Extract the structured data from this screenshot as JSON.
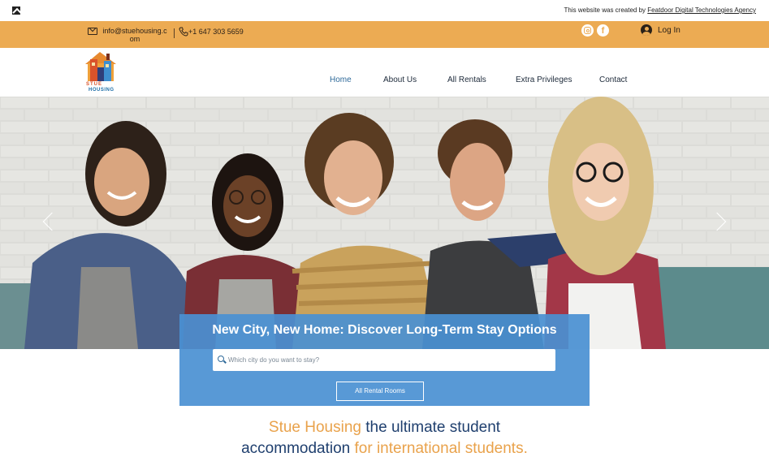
{
  "credit": {
    "text": "This website was created by",
    "link": "Featdoor Digital Technologies Agency"
  },
  "topbar": {
    "email": "info@stuehousing.com",
    "phone": "+1 647 303 5659",
    "login": "Log In"
  },
  "logo": {
    "line1": "STUE",
    "line2": "HOUSING"
  },
  "nav": {
    "items": [
      {
        "label": "Home"
      },
      {
        "label": "About Us"
      },
      {
        "label": "All Rentals"
      },
      {
        "label": "Extra Privileges"
      },
      {
        "label": "Contact"
      }
    ]
  },
  "hero": {
    "title": "New City, New Home: Discover Long-Term Stay Options",
    "search_placeholder": "Which city do you want to stay?",
    "button": "All Rental Rooms"
  },
  "tagline": {
    "p1": "Stue Housing",
    "p2": " the ultimate student",
    "p3": "accommodation",
    "p4": " for international students."
  },
  "colors": {
    "topbar": "#ecab53",
    "panel": "#4a90d2",
    "accent_orange": "#e9a24b",
    "accent_blue": "#1f3f6e"
  }
}
